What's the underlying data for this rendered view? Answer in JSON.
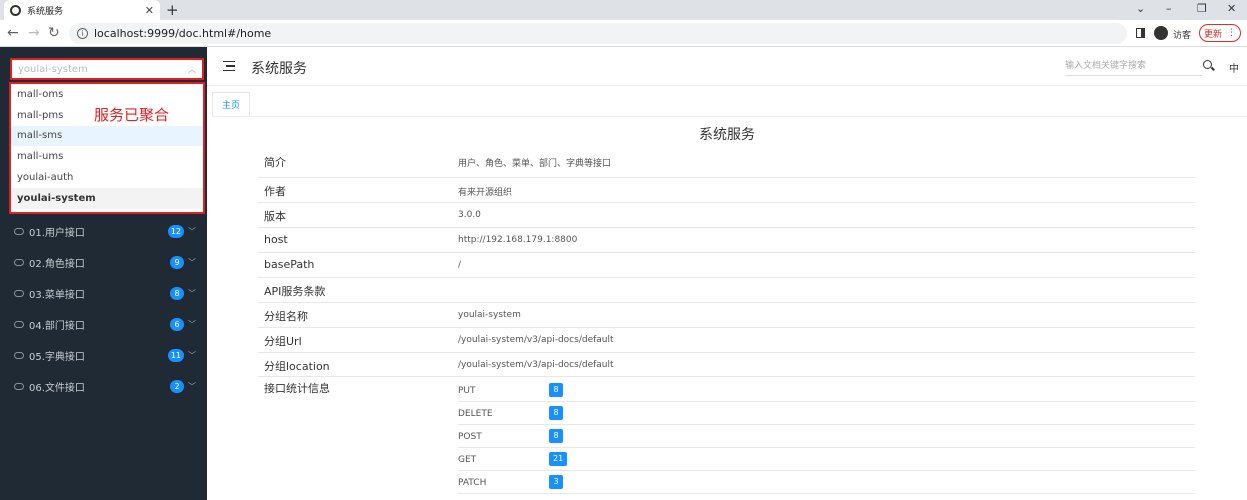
{
  "browser": {
    "tab_title": "系统服务",
    "new_tab": "+",
    "url": "localhost:9999/doc.html#/home",
    "guest_label": "访客",
    "update_label": "更新"
  },
  "sidebar": {
    "selected_service": "youlai-system",
    "options": [
      "mall-oms",
      "mall-pms",
      "mall-sms",
      "mall-ums",
      "youlai-auth",
      "youlai-system"
    ],
    "annotation": "服务已聚合",
    "menu": [
      {
        "label": "01.用户接口",
        "count": "12"
      },
      {
        "label": "02.角色接口",
        "count": "9"
      },
      {
        "label": "03.菜单接口",
        "count": "8"
      },
      {
        "label": "04.部门接口",
        "count": "6"
      },
      {
        "label": "05.字典接口",
        "count": "11"
      },
      {
        "label": "06.文件接口",
        "count": "2"
      }
    ]
  },
  "header": {
    "title": "系统服务",
    "search_placeholder": "输入文档关键字搜索",
    "lang": "中"
  },
  "tabs": {
    "home": "主页"
  },
  "doc": {
    "title": "系统服务",
    "rows": [
      {
        "key": "简介",
        "value": "用户、角色、菜单、部门、字典等接口"
      },
      {
        "key": "作者",
        "value": "有来开源组织"
      },
      {
        "key": "版本",
        "value": "3.0.0"
      },
      {
        "key": "host",
        "value": "http://192.168.179.1:8800"
      },
      {
        "key": "basePath",
        "value": "/"
      },
      {
        "key": "API服务条款",
        "value": ""
      },
      {
        "key": "分组名称",
        "value": "youlai-system"
      },
      {
        "key": "分组Url",
        "value": "/youlai-system/v3/api-docs/default"
      },
      {
        "key": "分组location",
        "value": "/youlai-system/v3/api-docs/default"
      },
      {
        "key": "接口统计信息",
        "value": ""
      }
    ],
    "stats": [
      {
        "method": "PUT",
        "count": "8"
      },
      {
        "method": "DELETE",
        "count": "8"
      },
      {
        "method": "POST",
        "count": "8"
      },
      {
        "method": "GET",
        "count": "21"
      },
      {
        "method": "PATCH",
        "count": "3"
      }
    ]
  },
  "colors": {
    "sidebar_bg": "#1f2a35",
    "accent": "#1890ff",
    "annotation": "#e02020"
  }
}
